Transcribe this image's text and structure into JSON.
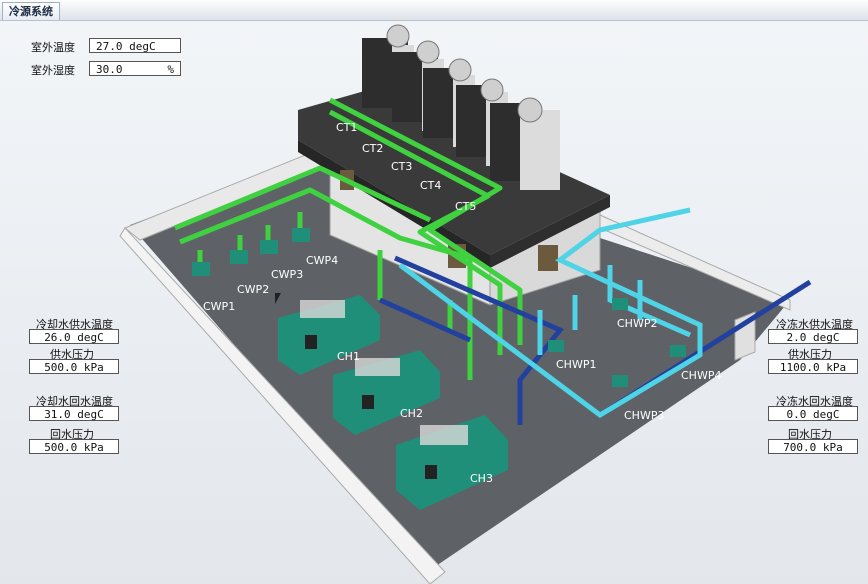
{
  "tab": {
    "label": "冷源系统"
  },
  "outdoor": {
    "temp_label": "室外温度",
    "temp_value": "27.0 degC",
    "humidity_label": "室外湿度",
    "humidity_value": "30.0",
    "humidity_unit": "%"
  },
  "cooling_water": {
    "supply_temp_label": "冷却水供水温度",
    "supply_temp_value": "26.0 degC",
    "supply_pressure_label": "供水压力",
    "supply_pressure_value": "500.0 kPa",
    "return_temp_label": "冷却水回水温度",
    "return_temp_value": "31.0 degC",
    "return_pressure_label": "回水压力",
    "return_pressure_value": "500.0 kPa"
  },
  "chilled_water": {
    "supply_temp_label": "冷冻水供水温度",
    "supply_temp_value": "2.0 degC",
    "supply_pressure_label": "供水压力",
    "supply_pressure_value": "1100.0 kPa",
    "return_temp_label": "冷冻水回水温度",
    "return_temp_value": "0.0 degC",
    "return_pressure_label": "回水压力",
    "return_pressure_value": "700.0 kPa"
  },
  "equipment": {
    "cooling_towers": [
      "CT1",
      "CT2",
      "CT3",
      "CT4",
      "CT5"
    ],
    "cooling_water_pumps": [
      "CWP1",
      "CWP2",
      "CWP3",
      "CWP4"
    ],
    "chillers": [
      "CH1",
      "CH2",
      "CH3"
    ],
    "chilled_water_pumps": [
      "CHWP1",
      "CHWP2",
      "CHWP3",
      "CHWP4"
    ]
  },
  "colors": {
    "cooling_pipe": "#3fd13f",
    "chilled_supply_pipe": "#22409e",
    "chilled_return_pipe": "#4fd3e6",
    "chiller_body": "#1f8f7a"
  }
}
